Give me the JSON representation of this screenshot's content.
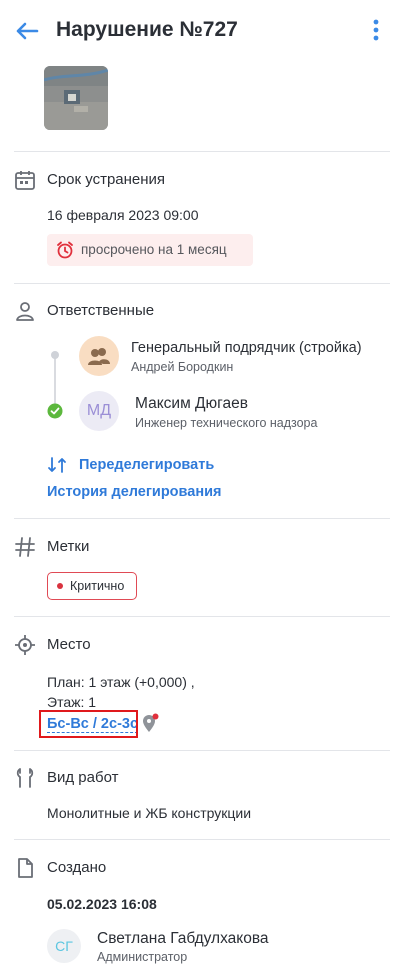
{
  "header": {
    "title": "Нарушение №727",
    "back_icon": "arrow-left-icon",
    "menu_icon": "kebab-menu-icon"
  },
  "deadline": {
    "title": "Срок устранения",
    "icon": "calendar-icon",
    "date": "16 февраля 2023 09:00",
    "overdue_label": "просрочено на 1 месяц"
  },
  "responsible": {
    "title": "Ответственные",
    "icon": "person-icon",
    "people": [
      {
        "name": "Генеральный подрядчик (стройка)",
        "role": "Андрей Бородкин"
      },
      {
        "initials": "МД",
        "name": "Максим Дюгаев",
        "role": "Инженер технического надзора"
      }
    ],
    "redelegate_label": "Переделегировать",
    "history_label": "История делегирования"
  },
  "tags": {
    "title": "Метки",
    "icon": "hashtag-icon",
    "items": [
      {
        "label": "Критично",
        "color": "#d9323f"
      }
    ]
  },
  "place": {
    "title": "Место",
    "icon": "target-icon",
    "plan": "План: 1 этаж (+0,000) ,",
    "floor": "Этаж: 1",
    "axes": "Бс-Вс / 2с-3с"
  },
  "work_type": {
    "title": "Вид работ",
    "icon": "wrench-icon",
    "value": "Монолитные и ЖБ конструкции"
  },
  "created": {
    "title": "Создано",
    "icon": "document-icon",
    "date": "05.02.2023 16:08",
    "initials": "СГ",
    "name": "Светлана Габдулхакова",
    "role": "Администратор"
  },
  "colors": {
    "accent": "#2f7ad9",
    "text": "#2b2f36",
    "overdue_bg": "#fdeeee",
    "danger": "#e0191c",
    "success": "#5cb83d"
  }
}
